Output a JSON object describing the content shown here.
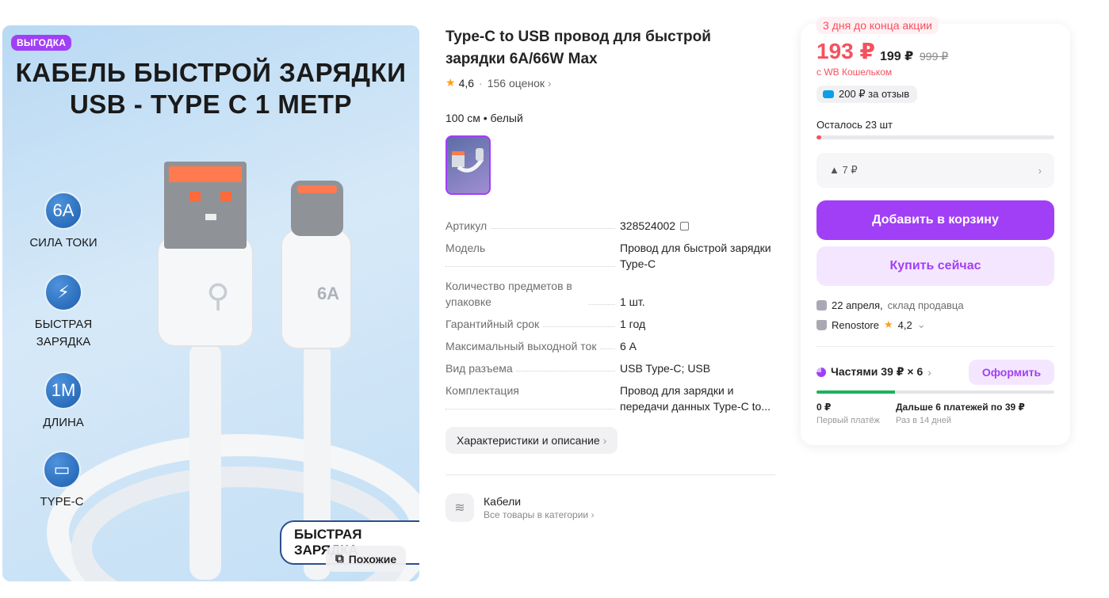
{
  "gallery": {
    "promo_badge": "ВЫГОДКА",
    "headline_line1": "КАБЕЛЬ БЫСТРОЙ ЗАРЯДКИ",
    "headline_line2": "USB - TYPE C 1 МЕТР",
    "features": [
      {
        "icon_text": "6A",
        "label": "СИЛА ТОКИ"
      },
      {
        "icon_text": "⚡",
        "label": "БЫСТРАЯ ЗАРЯДКА"
      },
      {
        "icon_text": "1M",
        "label": "ДЛИНА"
      },
      {
        "icon_text": "▭",
        "label": "TYPE-C"
      }
    ],
    "connector_label": "6A",
    "fast_charge_badge": "БЫСТРАЯ ЗАРЯДКА",
    "similar_button": "Похожие"
  },
  "product": {
    "title": "Type-C to USB провод для быстрой зарядки 6A/66W Max",
    "rating": "4,6",
    "reviews": "156 оценок",
    "variant": "100 см • белый"
  },
  "specs": [
    {
      "key": "Артикул",
      "value": "328524002"
    },
    {
      "key": "Модель",
      "value": "Провод для быстрой зарядки Type-C"
    },
    {
      "key": "Количество предметов в упаковке",
      "value": "1 шт."
    },
    {
      "key": "Гарантийный срок",
      "value": "1 год"
    },
    {
      "key": "Максимальный выходной ток",
      "value": "6 А"
    },
    {
      "key": "Вид разъема",
      "value": "USB Type-C; USB"
    },
    {
      "key": "Комплектация",
      "value": "Провод для зарядки и передачи данных Type-C to..."
    }
  ],
  "description_button": "Характеристики и описание",
  "category": {
    "name": "Кабели",
    "link": "Все товары в категории"
  },
  "buy_card": {
    "promo_timer": "3 дня до конца акции",
    "price": "193 ₽",
    "price_wb": "199 ₽",
    "price_old": "999 ₽",
    "wallet_note": "с WB Кошельком",
    "review_bonus": "200 ₽ за отзыв",
    "stock_label": "Осталось 23 шт",
    "stock_level": 0.02,
    "size_option": "▲ 7 ₽",
    "add_to_cart": "Добавить в корзину",
    "buy_now": "Купить сейчас",
    "delivery_date": "22 апреля,",
    "delivery_source": "склад продавца",
    "seller_name": "Renostore",
    "seller_rating": "4,2",
    "installments_label": "Частями 39 ₽ × 6",
    "checkout_button": "Оформить",
    "installments_progress": 0.33,
    "first_payment_amount": "0 ₽",
    "first_payment_label": "Первый платёж",
    "next_payments_amount": "Дальше 6 платежей по 39 ₽",
    "next_payments_label": "Раз в 14 дней"
  },
  "colors": {
    "brand": "#a13ff7",
    "price": "#f5515f",
    "installments_bar": "#19b35a"
  }
}
